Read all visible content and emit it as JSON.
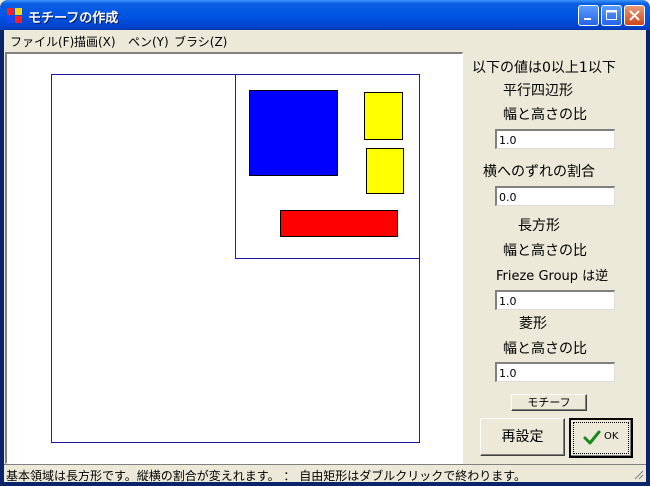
{
  "window": {
    "title": "モチーフの作成"
  },
  "menu": [
    {
      "label": "ファイル(F)"
    },
    {
      "label": "描画(X)"
    },
    {
      "label": "ペン(Y)"
    },
    {
      "label": "ブラシ(Z)"
    }
  ],
  "canvas": {
    "shapes": [
      {
        "name": "blue-square",
        "color": "#0000ff"
      },
      {
        "name": "yellow-rect-top",
        "color": "#ffff00"
      },
      {
        "name": "yellow-rect-bottom",
        "color": "#ffff00"
      },
      {
        "name": "red-bar",
        "color": "#ff0000"
      }
    ],
    "frame_color": "#1a1aa0"
  },
  "panel": {
    "header": "以下の値は0以上1以下",
    "parallelogram_label": "平行四辺形",
    "parallelogram_ratio_label": "幅と高さの比",
    "parallelogram_ratio_value": "1.0",
    "shift_label": "横へのずれの割合",
    "shift_value": "0.0",
    "rectangle_label": "長方形",
    "rectangle_ratio_label": "幅と高さの比",
    "frieze_note": "Frieze Group は逆",
    "rectangle_ratio_value": "1.0",
    "rhombus_label": "菱形",
    "rhombus_ratio_label": "幅と高さの比",
    "rhombus_ratio_value": "1.0",
    "motif_button": "モチーフ",
    "reset_button": "再設定",
    "ok_button": "OK"
  },
  "status": {
    "text": "基本領域は長方形です。縦横の割合が変えれます。 ： 自由矩形はダブルクリックで終わります。"
  }
}
